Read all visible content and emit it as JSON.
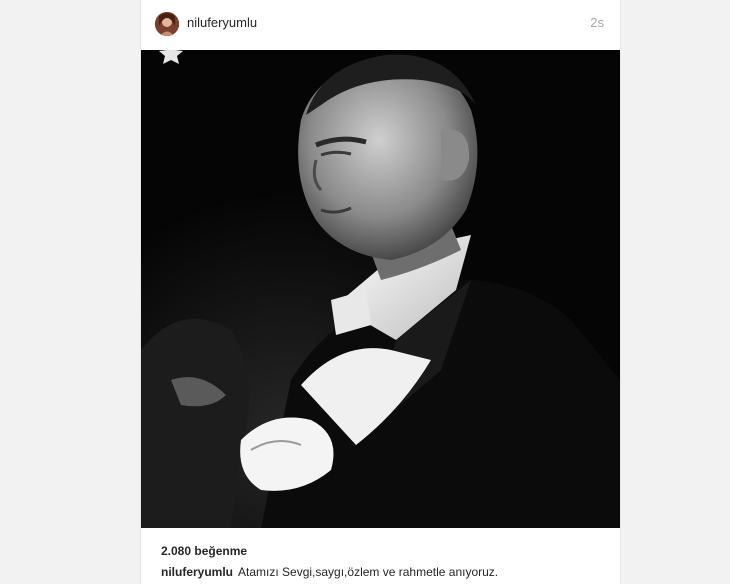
{
  "post": {
    "username": "niluferyumlu",
    "timestamp": "2s",
    "likes": "2.080 beğenme",
    "caption_user": "niluferyumlu",
    "caption_text": "Atamızı Sevgi,saygı,özlem ve rahmetle anıyoruz."
  },
  "icons": {
    "avatar": "profile-avatar",
    "photo_overlay": "star-icon"
  },
  "colors": {
    "text": "#262626",
    "muted": "#a8a8a8",
    "background": "#f2f2f2",
    "card": "#ffffff"
  }
}
